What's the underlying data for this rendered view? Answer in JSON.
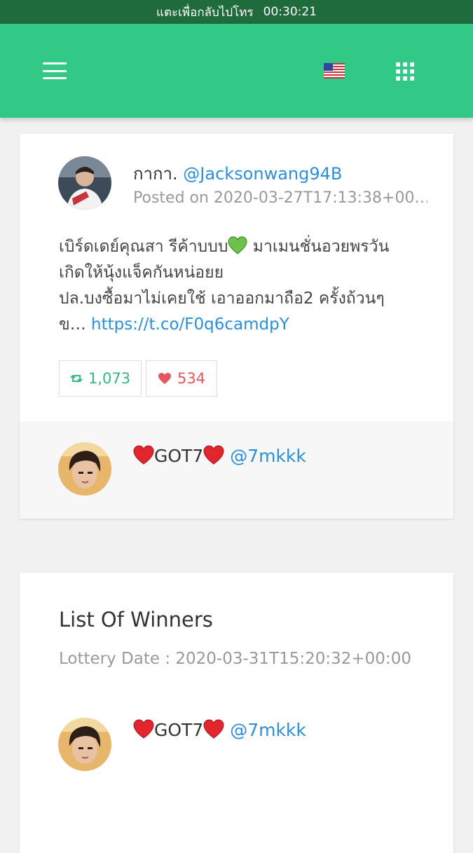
{
  "status_bar": {
    "call_text": "แตะเพื่อกลับไปโทร",
    "timer": "00:30:21"
  },
  "colors": {
    "app_bar": "#32c987",
    "status_bar": "#1f6b3c",
    "link": "#2b8fdd",
    "retweet": "#33b979",
    "like": "#e5555c"
  },
  "header": {
    "menu_icon": "hamburger-menu-icon",
    "language_icon": "us-flag-icon",
    "apps_icon": "grid-apps-icon"
  },
  "post": {
    "author_name": "กากา.",
    "author_handle": "@Jacksonwang94B",
    "posted_on": "Posted on 2020-03-27T17:13:38+00…",
    "text_line1_a": "เบิร์ดเดย์คุณสา รีค้าบบบ",
    "text_line1_b": " มาเมนชั่นอวยพรวัน",
    "text_line2": "เกิดให้นุ้งแจ็คกันหน่อยย",
    "text_line3": "ปล.บงซื้อมาไม่เคยใช้ เอาออกมาถือ2 ครั้งถ้วนๆ",
    "text_line4_prefix": "ข… ",
    "link": "https://t.co/F0q6camdpY",
    "retweets": "1,073",
    "likes": "534"
  },
  "winner_preview": {
    "name": "GOT7",
    "handle": "@7mkkk"
  },
  "winners": {
    "title": "List Of Winners",
    "lottery_date": "Lottery Date : 2020-03-31T15:20:32+00:00",
    "items": [
      {
        "name": "GOT7",
        "handle": "@7mkkk"
      }
    ]
  }
}
